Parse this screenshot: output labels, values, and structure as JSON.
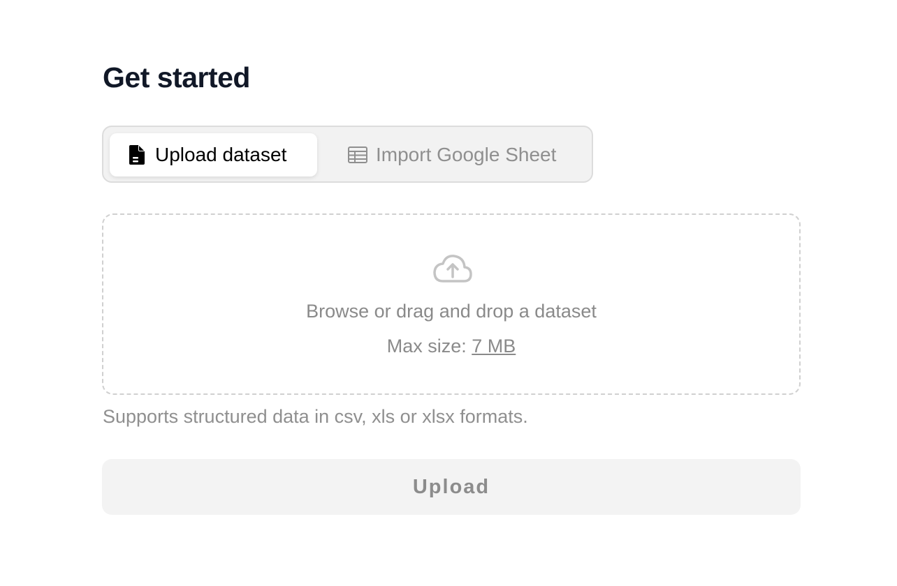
{
  "header": {
    "title": "Get started"
  },
  "tabs": [
    {
      "label": "Upload dataset",
      "icon": "document-icon",
      "active": true
    },
    {
      "label": "Import Google Sheet",
      "icon": "spreadsheet-icon",
      "active": false
    }
  ],
  "dropzone": {
    "icon": "cloud-upload-icon",
    "prompt": "Browse or drag and drop a dataset",
    "max_size_label": "Max size: ",
    "max_size_value": "7 MB"
  },
  "help_text": "Supports structured data in csv, xls or xlsx formats.",
  "upload_button": {
    "label": "Upload",
    "enabled": false
  },
  "colors": {
    "title": "#111827",
    "active_tab_text": "#000000",
    "inactive_text": "#8f8f8f",
    "tab_group_bg": "#f2f2f2",
    "button_bg": "#f3f3f3",
    "dashed_border": "#d0d0d0"
  }
}
